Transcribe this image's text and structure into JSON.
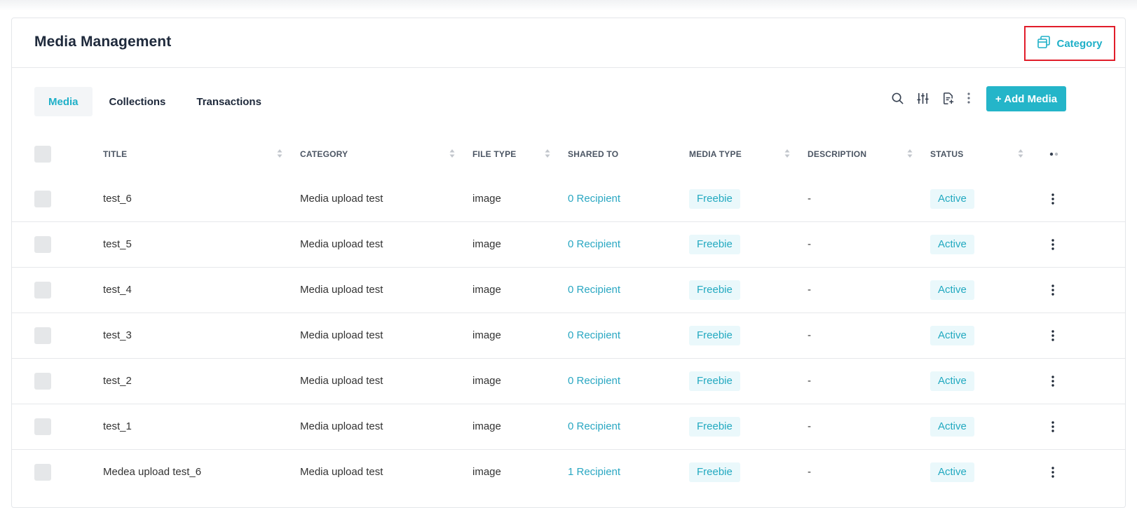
{
  "header": {
    "title": "Media Management",
    "category_label": "Category"
  },
  "tabs": [
    {
      "label": "Media",
      "active": true
    },
    {
      "label": "Collections",
      "active": false
    },
    {
      "label": "Transactions",
      "active": false
    }
  ],
  "toolbar": {
    "add_label": "+ Add Media",
    "icons": [
      "search-icon",
      "filter-sliders-icon",
      "export-document-icon",
      "more-vertical-icon"
    ]
  },
  "table": {
    "columns": [
      "TITLE",
      "CATEGORY",
      "FILE TYPE",
      "SHARED TO",
      "MEDIA TYPE",
      "DESCRIPTION",
      "STATUS"
    ],
    "rows": [
      {
        "title": "test_6",
        "category": "Media upload test",
        "file_type": "image",
        "shared_to": "0 Recipient",
        "media_type": "Freebie",
        "description": "-",
        "status": "Active"
      },
      {
        "title": "test_5",
        "category": "Media upload test",
        "file_type": "image",
        "shared_to": "0 Recipient",
        "media_type": "Freebie",
        "description": "-",
        "status": "Active"
      },
      {
        "title": "test_4",
        "category": "Media upload test",
        "file_type": "image",
        "shared_to": "0 Recipient",
        "media_type": "Freebie",
        "description": "-",
        "status": "Active"
      },
      {
        "title": "test_3",
        "category": "Media upload test",
        "file_type": "image",
        "shared_to": "0 Recipient",
        "media_type": "Freebie",
        "description": "-",
        "status": "Active"
      },
      {
        "title": "test_2",
        "category": "Media upload test",
        "file_type": "image",
        "shared_to": "0 Recipient",
        "media_type": "Freebie",
        "description": "-",
        "status": "Active"
      },
      {
        "title": "test_1",
        "category": "Media upload test",
        "file_type": "image",
        "shared_to": "0 Recipient",
        "media_type": "Freebie",
        "description": "-",
        "status": "Active"
      },
      {
        "title": "Medea upload test_6",
        "category": "Media upload test",
        "file_type": "image",
        "shared_to": "1 Recipient",
        "media_type": "Freebie",
        "description": "-",
        "status": "Active"
      }
    ]
  },
  "colors": {
    "accent": "#24b5c9",
    "highlight_border": "#e11d2a",
    "pill_bg": "#eaf8fb"
  }
}
